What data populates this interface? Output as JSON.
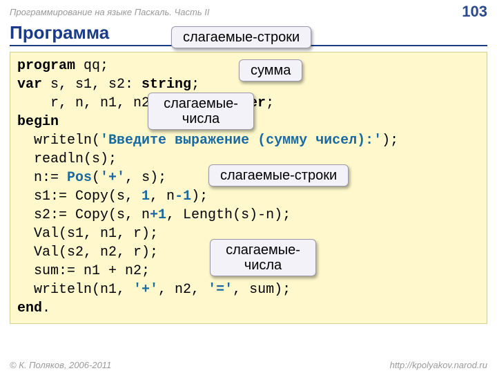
{
  "header": {
    "subject": "Программирование на языке Паскаль. Часть II",
    "page": "103"
  },
  "title": "Программа",
  "callouts": {
    "c1": "слагаемые-строки",
    "c2": "сумма",
    "c3a": "слагаемые-",
    "c3b": "числа",
    "c4": "слагаемые-строки",
    "c5a": "слагаемые-",
    "c5b": "числа"
  },
  "code": {
    "l1a": "program",
    "l1b": " qq;",
    "l2a": "var",
    "l2b": " s, s1, s2: ",
    "l2c": "string",
    "l2d": ";",
    "l3a": "    r, n, n1, n2, sum: ",
    "l3b": "integer",
    "l3c": ";",
    "l4": "begin",
    "l5a": "  writeln(",
    "l5b": "'Введите выражение (сумму чисел):'",
    "l5c": ");",
    "l6": "  readln(s);",
    "l7a": "  n:= ",
    "l7b": "Pos",
    "l7c": "(",
    "l7d": "'+'",
    "l7e": ", s);",
    "l8a": "  s1:= Copy(s, ",
    "l8b": "1",
    "l8c": ", n",
    "l8d": "-1",
    "l8e": ");",
    "l9a": "  s2:= Copy(s, n",
    "l9b": "+1",
    "l9c": ", Length(s)-n);",
    "l10": "  Val(s1, n1, r);",
    "l11": "  Val(s2, n2, r);",
    "l12": "  sum:= n1 + n2;",
    "l13a": "  writeln(n1, ",
    "l13b": "'+'",
    "l13c": ", n2, ",
    "l13d": "'='",
    "l13e": ", sum);",
    "l14a": "end",
    "l14b": "."
  },
  "footer": {
    "left": "© К. Поляков, 2006-2011",
    "right": "http://kpolyakov.narod.ru"
  }
}
